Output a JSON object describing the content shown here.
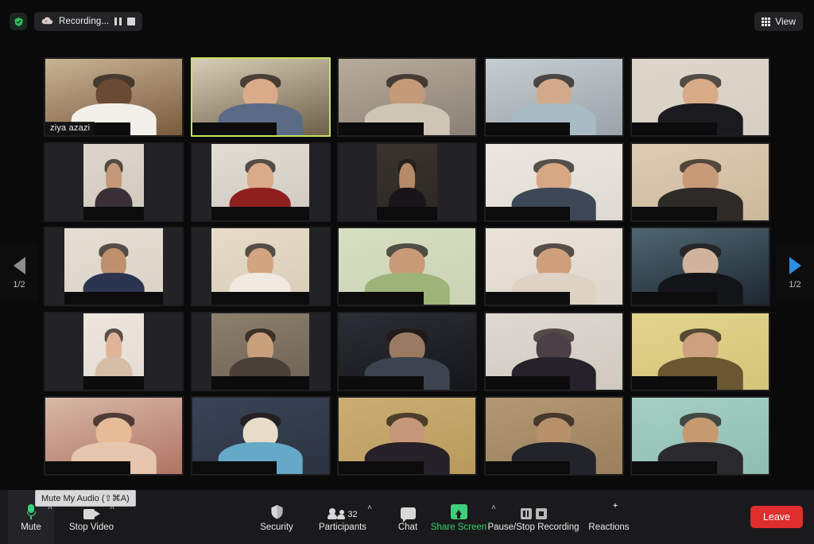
{
  "topbar": {
    "shield_icon": "shield-check-icon",
    "recording": {
      "cloud_icon": "cloud-recording-icon",
      "label": "Recording...",
      "pause_icon": "pause-icon",
      "stop_icon": "stop-icon"
    },
    "view_button": {
      "icon": "grid-view-icon",
      "label": "View"
    }
  },
  "gallery": {
    "active_tile_index": 1,
    "active_border_color": "#c3e362",
    "tiles": [
      {
        "name_tag": "ziya azazi",
        "bg": "#7a5a3e",
        "wall": "#c9b395",
        "skin": "#6b4a33",
        "shirt": "#f2f0ea",
        "crop": "full"
      },
      {
        "name_tag": "",
        "bg": "#6d6048",
        "wall": "#d8cdb6",
        "skin": "#d9ab88",
        "shirt": "#5b6b86",
        "crop": "full"
      },
      {
        "name_tag": "",
        "bg": "#8a8076",
        "wall": "#b9ab9c",
        "skin": "#c59a78",
        "shirt": "#cfc6b8",
        "crop": "full"
      },
      {
        "name_tag": "",
        "bg": "#9aa3a8",
        "wall": "#c6cdd1",
        "skin": "#d2a98a",
        "shirt": "#a9bcc6",
        "crop": "full"
      },
      {
        "name_tag": "",
        "bg": "#d6cfc4",
        "wall": "#ded7cb",
        "skin": "#d8ab88",
        "shirt": "#1b1b1f",
        "crop": "full"
      },
      {
        "name_tag": "",
        "bg": "#cfc8bd",
        "wall": "#dcd6cc",
        "skin": "#c49878",
        "shirt": "#3a3038",
        "crop": "narrow"
      },
      {
        "name_tag": "",
        "bg": "#cfcac0",
        "wall": "#e2ddd4",
        "skin": "#d9ab8a",
        "shirt": "#8e2020",
        "crop": "mid"
      },
      {
        "name_tag": "",
        "bg": "#2a2724",
        "wall": "#3a342e",
        "skin": "#b48a68",
        "shirt": "#171519",
        "crop": "narrow"
      },
      {
        "name_tag": "",
        "bg": "#dedad2",
        "wall": "#ece8e1",
        "skin": "#d6a785",
        "shirt": "#3d4756",
        "crop": "full"
      },
      {
        "name_tag": "",
        "bg": "#cbb99b",
        "wall": "#ddcdb1",
        "skin": "#c79a78",
        "shirt": "#2e2a28",
        "crop": "full"
      },
      {
        "name_tag": "",
        "bg": "#d9d3c8",
        "wall": "#e4ded3",
        "skin": "#c0906d",
        "shirt": "#2c3550",
        "crop": "mid"
      },
      {
        "name_tag": "",
        "bg": "#d7cdb8",
        "wall": "#e6dcc8",
        "skin": "#d3a482",
        "shirt": "#efe9e0",
        "crop": "mid"
      },
      {
        "name_tag": "",
        "bg": "#c9d2b4",
        "wall": "#d8e0c4",
        "skin": "#c99a77",
        "shirt": "#9db377",
        "crop": "full"
      },
      {
        "name_tag": "",
        "bg": "#ded6cc",
        "wall": "#eae3d9",
        "skin": "#cf9e7b",
        "shirt": "#ddd2c3",
        "crop": "full"
      },
      {
        "name_tag": "",
        "bg": "#1d2730",
        "wall": "#4f6672",
        "skin": "#cfb39a",
        "shirt": "#131418",
        "crop": "full"
      },
      {
        "name_tag": "",
        "bg": "#e3dcd2",
        "wall": "#ece6dd",
        "skin": "#e0b595",
        "shirt": "#d5bda8",
        "crop": "narrow"
      },
      {
        "name_tag": "",
        "bg": "#6d6254",
        "wall": "#8b7f6d",
        "skin": "#c9a07c",
        "shirt": "#4a4038",
        "crop": "mid"
      },
      {
        "name_tag": "",
        "bg": "#15161a",
        "wall": "#2b2e35",
        "skin": "#9a7a62",
        "shirt": "#3c4450",
        "crop": "full"
      },
      {
        "name_tag": "",
        "bg": "#cfc9c0",
        "wall": "#ded9d1",
        "skin": "#4a4046",
        "shirt": "#26222a",
        "crop": "full"
      },
      {
        "name_tag": "",
        "bg": "#d4c47a",
        "wall": "#e2d48e",
        "skin": "#cda180",
        "shirt": "#6a5630",
        "crop": "full"
      },
      {
        "name_tag": "",
        "bg": "#b07464",
        "wall": "#d7b8a6",
        "skin": "#e5bb98",
        "shirt": "#e6c6ae",
        "crop": "full"
      },
      {
        "name_tag": "",
        "bg": "#2b3340",
        "wall": "#3b4456",
        "skin": "#e6dcc8",
        "shirt": "#66a8c8",
        "crop": "full"
      },
      {
        "name_tag": "",
        "bg": "#b99a5c",
        "wall": "#cbae74",
        "skin": "#c49878",
        "shirt": "#262028",
        "crop": "full"
      },
      {
        "name_tag": "",
        "bg": "#9a7f5e",
        "wall": "#b39873",
        "skin": "#b8906c",
        "shirt": "#22242a",
        "crop": "full"
      },
      {
        "name_tag": "",
        "bg": "#8fbdb2",
        "wall": "#a6cfc4",
        "skin": "#c6996f",
        "shirt": "#2a2a2e",
        "crop": "full"
      }
    ]
  },
  "navigation": {
    "prev": {
      "icon": "triangle-left-icon",
      "page_label": "1/2",
      "color": "#8c8c8c"
    },
    "next": {
      "icon": "triangle-right-icon",
      "page_label": "1/2",
      "color": "#2e8fe0"
    }
  },
  "tooltip": {
    "text": "Mute My Audio (⇧⌘A)"
  },
  "toolbar": {
    "mute": {
      "icon": "microphone-icon",
      "label": "Mute",
      "caret": "˄"
    },
    "video": {
      "icon": "camera-icon",
      "label": "Stop Video",
      "caret": "˄"
    },
    "security": {
      "icon": "shield-icon",
      "label": "Security"
    },
    "participants": {
      "icon": "participants-icon",
      "label": "Participants",
      "count": "32",
      "caret": "˄"
    },
    "chat": {
      "icon": "chat-bubble-icon",
      "label": "Chat"
    },
    "share": {
      "icon": "share-screen-icon",
      "label": "Share Screen",
      "caret": "˄",
      "color": "#38d06c"
    },
    "recording": {
      "pause_icon": "pause-icon",
      "stop_icon": "stop-icon",
      "label": "Pause/Stop Recording"
    },
    "reactions": {
      "icon": "reactions-icon",
      "label": "Reactions"
    },
    "leave": {
      "label": "Leave",
      "color": "#e02d2d"
    }
  }
}
